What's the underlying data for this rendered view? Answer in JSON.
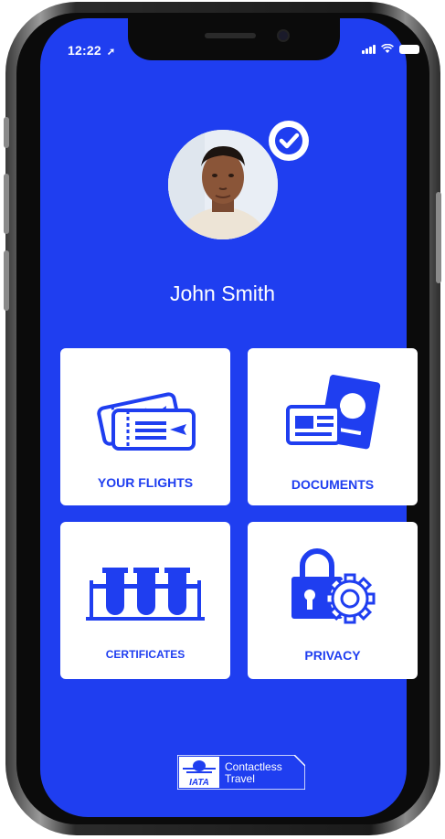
{
  "status_bar": {
    "time": "12:22",
    "location_icon": "location-arrow-icon",
    "signal_icon": "cellular-signal-icon",
    "wifi_icon": "wifi-icon",
    "battery_icon": "battery-icon"
  },
  "profile": {
    "name": "John Smith",
    "verified_icon": "checkmark-badge-icon"
  },
  "tiles": [
    {
      "label": "YOUR FLIGHTS",
      "icon": "boarding-pass-icon"
    },
    {
      "label": "DOCUMENTS",
      "icon": "passport-id-card-icon"
    },
    {
      "label": "CERTIFICATES",
      "icon": "test-tubes-icon"
    },
    {
      "label": "PRIVACY",
      "icon": "padlock-gear-icon"
    }
  ],
  "footer": {
    "logo_text": "IATA",
    "badge_line1": "Contactless",
    "badge_line2": "Travel"
  },
  "colors": {
    "background": "#1f3ef0",
    "tile": "#ffffff",
    "accent": "#1f3ef0"
  }
}
